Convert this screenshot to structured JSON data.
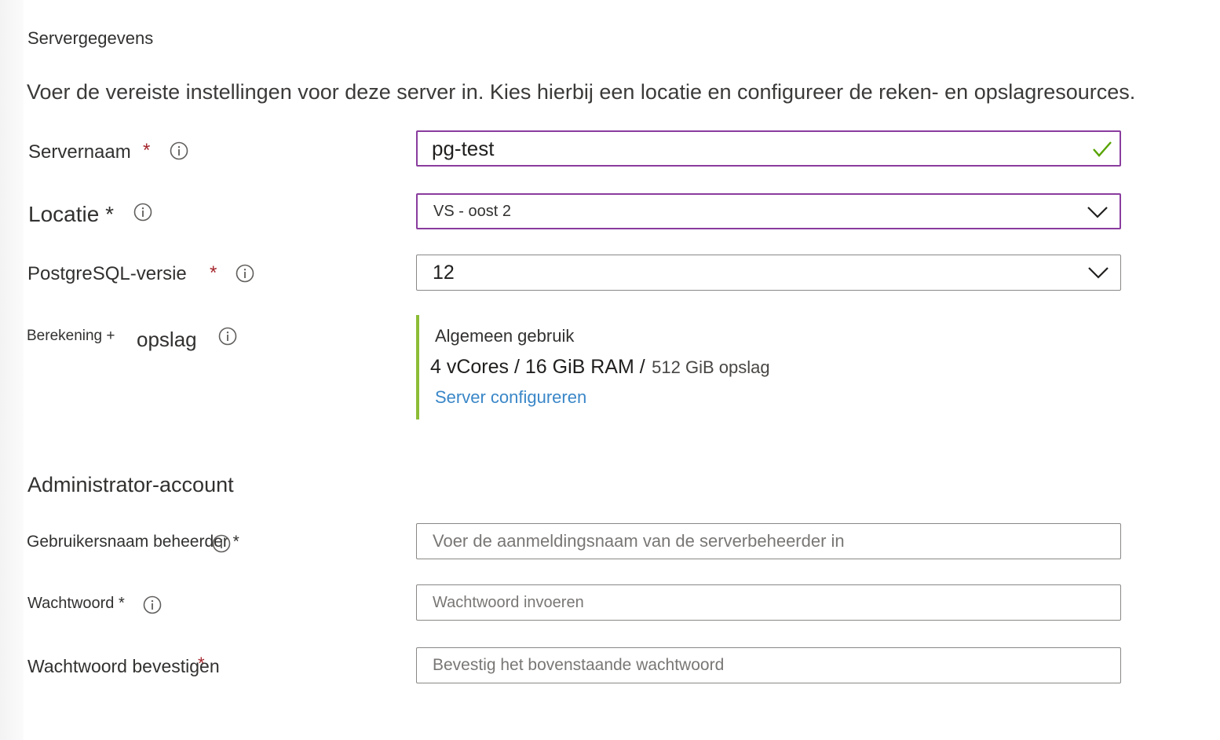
{
  "section": {
    "title": "Servergegevens",
    "description": "Voer de vereiste instellingen voor deze server in. Kies hierbij een locatie en configureer de reken- en opslagresources."
  },
  "server_name": {
    "label": "Servernaam",
    "required": "*",
    "value": "pg-test"
  },
  "location": {
    "label": "Locatie *",
    "value": "VS - oost 2"
  },
  "version": {
    "label": "PostgreSQL-versie",
    "required": "*",
    "value": "12"
  },
  "compute": {
    "label_part1": "Berekening +",
    "label_part2": "opslag",
    "tier": "Algemeen gebruik",
    "spec_main": "4 vCores / 16 GiB RAM /",
    "spec_storage": "512 GiB opslag",
    "configure_link": "Server configureren"
  },
  "admin": {
    "title": "Administrator-account",
    "username_label": "Gebruikersnaam beheerder *",
    "username_placeholder": "Voer de aanmeldingsnaam van de serverbeheerder in",
    "password_label": "Wachtwoord *",
    "password_placeholder": "Wachtwoord invoeren",
    "confirm_label": "Wachtwoord bevestigen",
    "confirm_required": "*",
    "confirm_placeholder": "Bevestig het bovenstaande wachtwoord"
  },
  "colors": {
    "focus_border": "#8a3c9e",
    "required": "#a4262c",
    "valid_check": "#57a300",
    "link": "#3a87c8",
    "compute_accent": "#8cbd36"
  },
  "icons": {
    "info": "info-icon",
    "chevron": "chevron-down-icon",
    "check": "checkmark-icon"
  }
}
